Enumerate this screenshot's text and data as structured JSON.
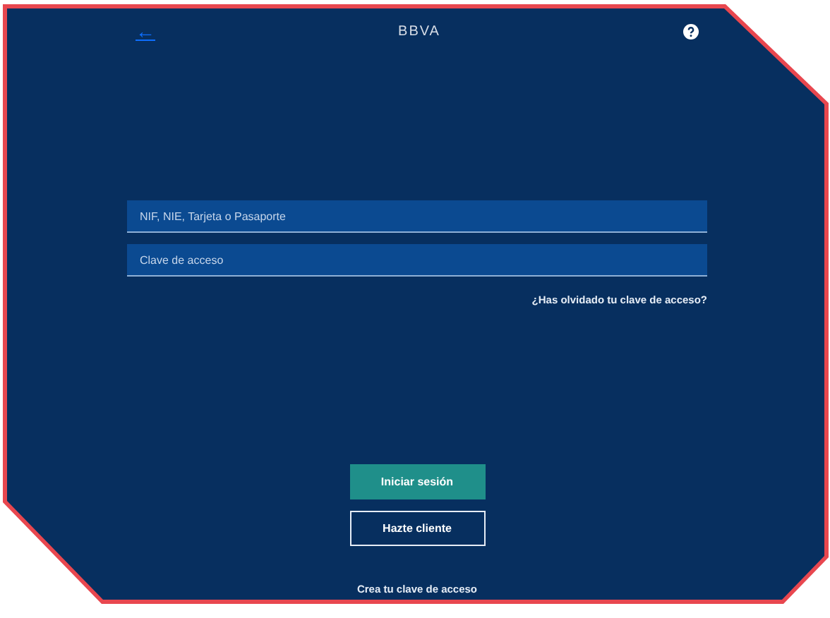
{
  "header": {
    "back_icon": "←",
    "logo": "BBVA"
  },
  "form": {
    "fields": [
      {
        "placeholder": "NIF, NIE, Tarjeta o Pasaporte"
      },
      {
        "placeholder": "Clave de acceso"
      }
    ],
    "forgot_link": "¿Has olvidado tu clave de acceso?"
  },
  "buttons": [
    {
      "label": "Iniciar sesión",
      "kind": "primary"
    },
    {
      "label": "Hazte cliente",
      "kind": "outline"
    }
  ],
  "footer_link": "Crea tu clave de acceso"
}
